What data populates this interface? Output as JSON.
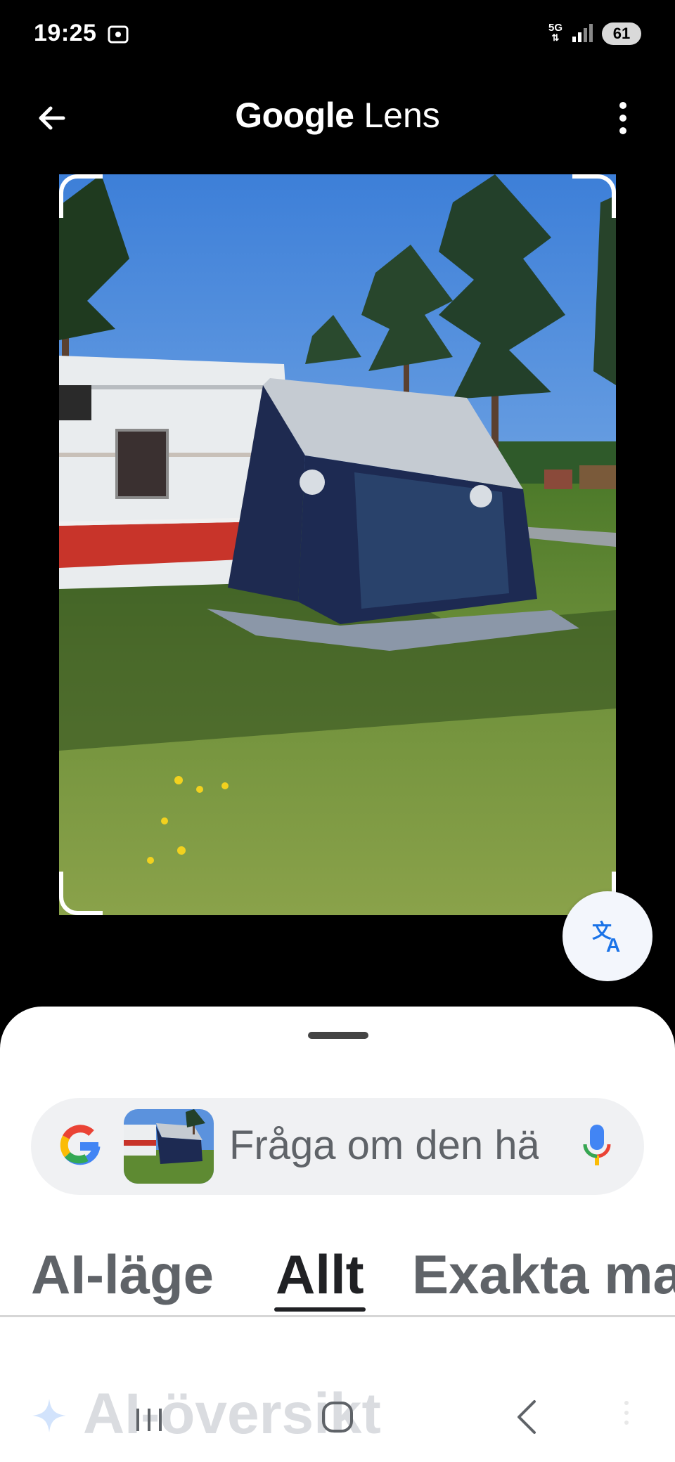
{
  "status_bar": {
    "time": "19:25",
    "network_label": "5G",
    "battery_level": "61",
    "icons": [
      "screenshot-icon",
      "network-5g-icon",
      "signal-icon",
      "battery-icon"
    ]
  },
  "app_bar": {
    "title_brand": "Google",
    "title_product": "Lens",
    "icons": [
      "arrow-back-icon",
      "more-vert-icon"
    ]
  },
  "image": {
    "description_icon": "selected-photo",
    "action_icon": "translate-icon"
  },
  "search": {
    "placeholder": "Fråga om den här bilden",
    "visible_text": "Fråga om den hä",
    "icons": [
      "google-g-icon",
      "thumbnail-image",
      "microphone-icon"
    ]
  },
  "tabs": [
    {
      "label": "AI-läge",
      "selected": false
    },
    {
      "label": "Allt",
      "selected": true
    },
    {
      "label": "Exakta matchningar",
      "visible_text": "Exakta ma",
      "selected": false
    }
  ],
  "ai_overview": {
    "title": "AI-översikt",
    "icon": "sparkle-icon"
  },
  "nav_bar": {
    "icons": [
      "recent-apps-icon",
      "home-icon",
      "back-icon"
    ]
  },
  "colors": {
    "background": "#000000",
    "sheet": "#ffffff",
    "pill": "#f0f1f3",
    "translate_accent": "#1a73e8",
    "text_dark": "#202124",
    "text_grey": "#5f6368"
  }
}
